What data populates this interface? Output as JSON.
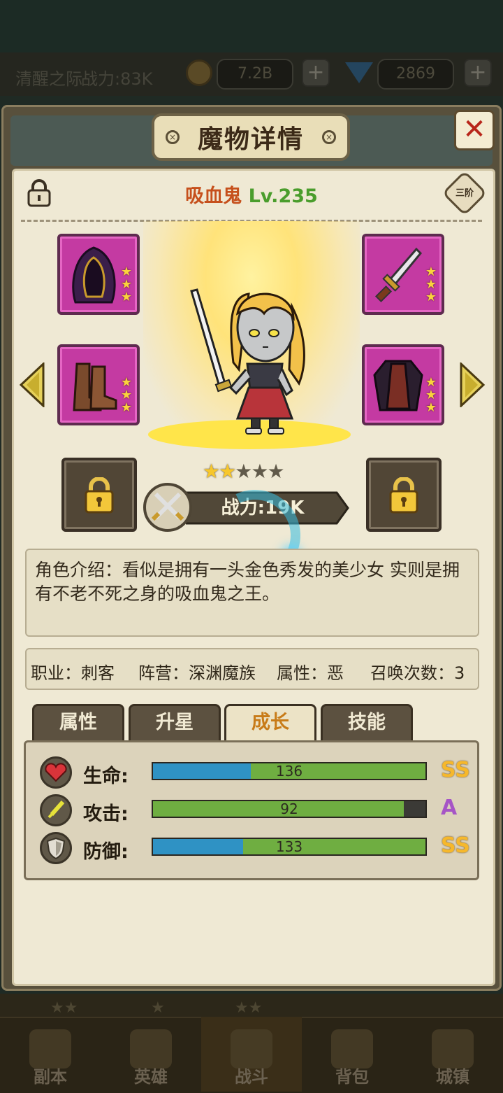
{
  "topbar": {
    "region_label": "清醒之际",
    "power_label": "战力:83K",
    "gold_value": "7.2B",
    "gem_value": "2869",
    "plus_label": "+"
  },
  "panel": {
    "title": "魔物详情",
    "close_label": "✕"
  },
  "hero": {
    "name": "吸血鬼",
    "level": "Lv.235",
    "rank": "三阶",
    "stars_total": 5,
    "stars_filled": 2,
    "power_label": "战力:19K",
    "intro": "角色介绍：看似是拥有一头金色秀发的美少女 实则是拥有不老不死之身的吸血鬼之王。",
    "class_label": "职业：刺客",
    "faction_label": "阵营：深渊魔族",
    "alignment_label": "属性：恶",
    "summon_label": "召唤次数：3"
  },
  "equipment": [
    {
      "slot": "hood",
      "stars": 3
    },
    {
      "slot": "dagger",
      "stars": 3
    },
    {
      "slot": "boots",
      "stars": 3
    },
    {
      "slot": "armor",
      "stars": 3
    }
  ],
  "tabs": [
    {
      "label": "属性",
      "active": false
    },
    {
      "label": "升星",
      "active": false
    },
    {
      "label": "成长",
      "active": true
    },
    {
      "label": "技能",
      "active": false
    }
  ],
  "stats": [
    {
      "label": "生命:",
      "value": "136",
      "grade": "SS",
      "blue_fraction": 0.36,
      "green_fraction": 0.64,
      "icon": "heart-icon"
    },
    {
      "label": "攻击:",
      "value": "92",
      "grade": "A",
      "blue_fraction": 0.0,
      "green_fraction": 0.92,
      "icon": "sword-icon"
    },
    {
      "label": "防御:",
      "value": "133",
      "grade": "SS",
      "blue_fraction": 0.33,
      "green_fraction": 0.67,
      "icon": "shield-icon"
    }
  ],
  "nav": [
    {
      "label": "副本",
      "active": false
    },
    {
      "label": "英雄",
      "active": false
    },
    {
      "label": "战斗",
      "active": true
    },
    {
      "label": "背包",
      "active": false
    },
    {
      "label": "城镇",
      "active": false
    }
  ],
  "colors": {
    "hero_name": "#c6501c",
    "hero_level": "#4a9d2c",
    "grade_ss": "#f6b82c",
    "grade_a": "#a655c6",
    "bar_blue": "#2f92c4",
    "bar_green": "#6fae41"
  }
}
